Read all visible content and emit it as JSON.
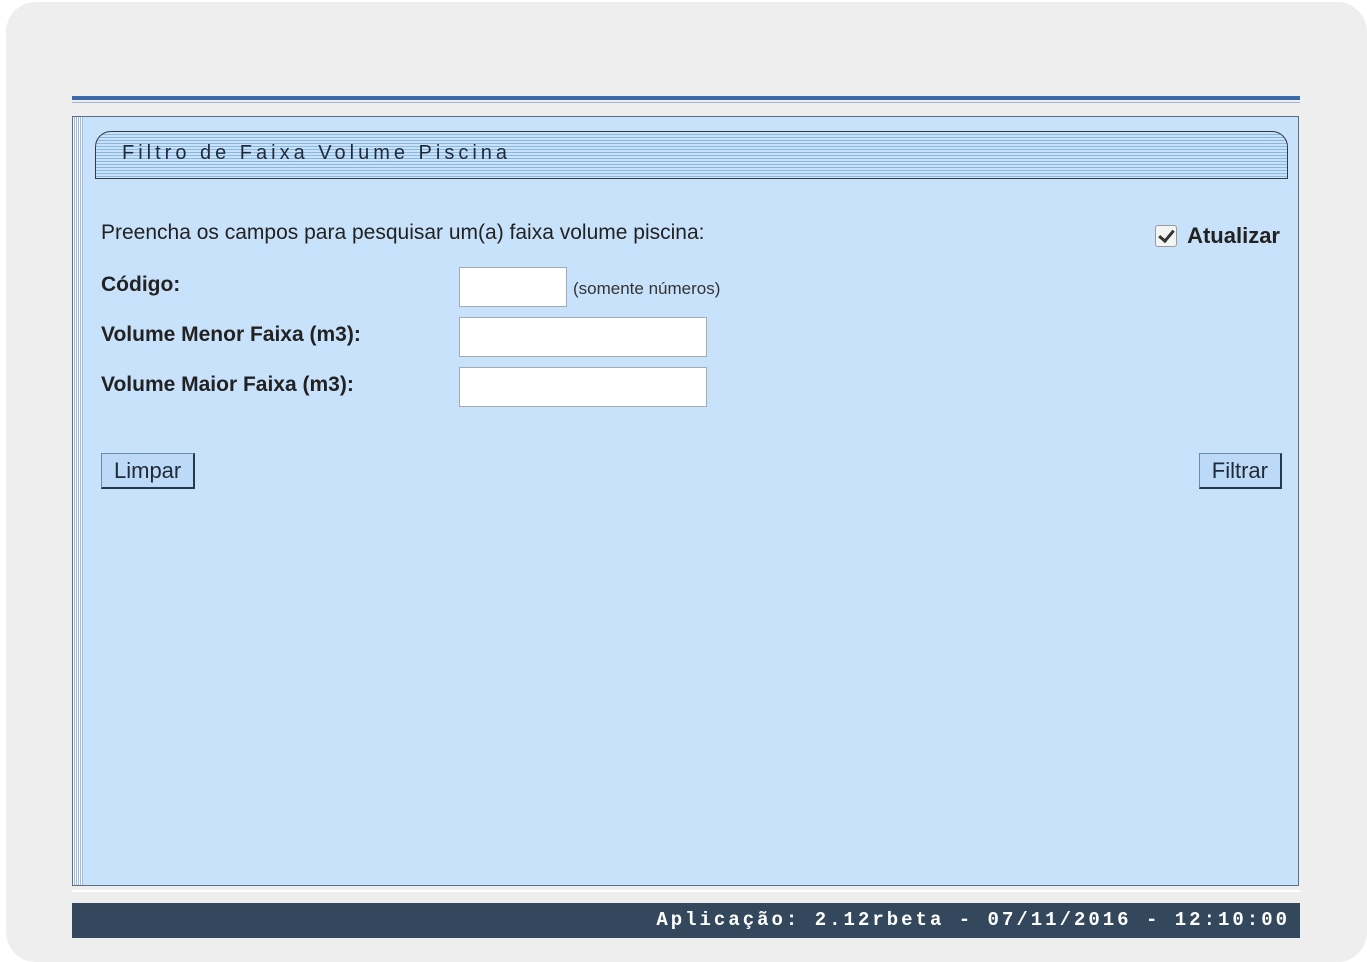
{
  "panel": {
    "title": "Filtro de Faixa Volume Piscina",
    "intro": "Preencha os campos para pesquisar um(a) faixa volume piscina:",
    "atualizar_label": "Atualizar",
    "atualizar_checked": true
  },
  "fields": {
    "codigo_label": "Código:",
    "codigo_hint": "(somente números)",
    "codigo_value": "",
    "volume_menor_label": "Volume Menor Faixa (m3):",
    "volume_menor_value": "",
    "volume_maior_label": "Volume Maior Faixa (m3):",
    "volume_maior_value": ""
  },
  "buttons": {
    "limpar": "Limpar",
    "filtrar": "Filtrar"
  },
  "footer": {
    "text": "Aplicação: 2.12rbeta - 07/11/2016 - 12:10:00"
  },
  "colors": {
    "panel_bg": "#c9e2fb",
    "footer_bg": "#33475d",
    "accent_rule": "#3a6aa8"
  }
}
